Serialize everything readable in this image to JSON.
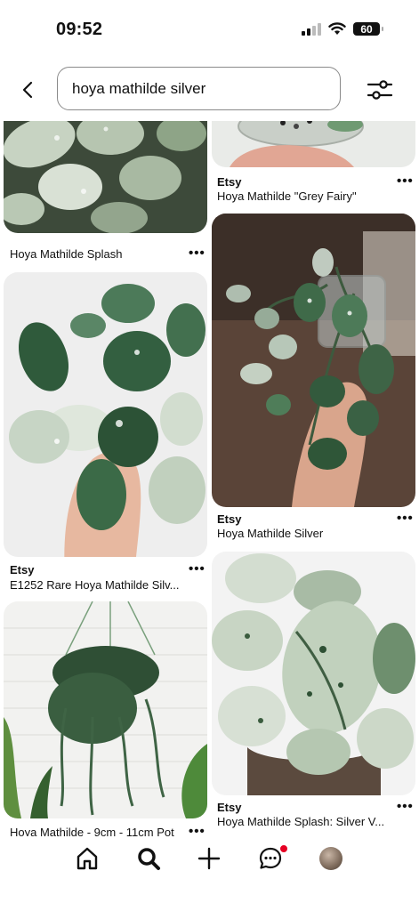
{
  "status_bar": {
    "time": "09:52",
    "battery": "60"
  },
  "search": {
    "query": "hoya mathilde silver"
  },
  "pins": {
    "p1": {
      "title": "Hoya Mathilde Splash"
    },
    "p2": {
      "source": "Etsy",
      "title": "Hoya Mathilde \"Grey Fairy\""
    },
    "p3": {
      "source": "Etsy",
      "title": "E1252 Rare Hoya Mathilde Silv..."
    },
    "p4": {
      "source": "Etsy",
      "title": "Hoya Mathilde Silver"
    },
    "p5": {
      "title": "Hoya Mathilde - 9cm - 11cm Pot"
    },
    "p6": {
      "source": "Etsy",
      "title": "Hoya Mathilde Splash: Silver V..."
    }
  },
  "more_label": "•••",
  "tabbar": {
    "items": [
      "home-icon",
      "search-icon",
      "create-icon",
      "messages-icon",
      "profile-icon"
    ],
    "notification_color": "#e60023"
  }
}
